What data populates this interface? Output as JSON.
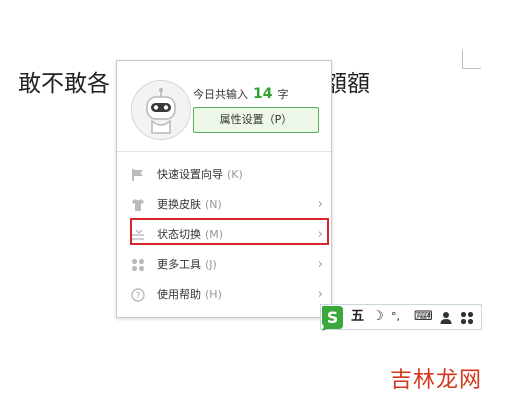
{
  "document": {
    "text_left": "敢不敢各",
    "text_right": "額額"
  },
  "popup": {
    "count_prefix": "今日共输入",
    "count_value": "14",
    "count_suffix": "字",
    "property_button": "属性设置（P）",
    "menu_items": [
      {
        "label": "快速设置向导",
        "shortcut": "(K)",
        "icon": "flag-icon",
        "has_submenu": false
      },
      {
        "label": "更换皮肤",
        "shortcut": "(N)",
        "icon": "shirt-icon",
        "has_submenu": true
      },
      {
        "label": "状态切换",
        "shortcut": "(M)",
        "icon": "switch-icon",
        "has_submenu": true
      },
      {
        "label": "更多工具",
        "shortcut": "(J)",
        "icon": "tools-grid-icon",
        "has_submenu": true
      },
      {
        "label": "使用帮助",
        "shortcut": "(H)",
        "icon": "help-icon",
        "has_submenu": true
      }
    ],
    "chevron": "›",
    "highlighted_item": "状态切换"
  },
  "ime_toolbar": {
    "logo_letter": "S",
    "wubi_char": "五",
    "moon": "☽",
    "punct": "°,",
    "keyboard": "⌨",
    "user": "👤",
    "grid": "⁘",
    "logo_color": "#3aa73a"
  },
  "watermark": {
    "text": "吉林龙网"
  },
  "colors": {
    "highlight_border": "#d6262c",
    "count_value": "#2fa52f",
    "button_border": "#59b159",
    "watermark": "#d3381c"
  }
}
